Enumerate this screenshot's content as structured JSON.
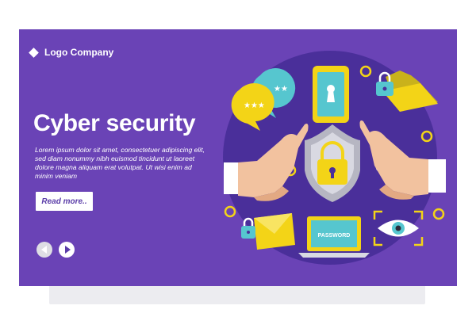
{
  "logo": {
    "text": "Logo Company"
  },
  "hero": {
    "title": "Cyber security",
    "body": "Lorem ipsum dolor sit amet, consectetuer adipiscing elit, sed diam nonummy nibh euismod tincidunt ut laoreet dolore magna aliquam erat volutpat. Ut wisi enim ad minim veniam",
    "read_more_label": "Read more.."
  },
  "illustration": {
    "laptop_screen_text": "PASSWORD",
    "icons": [
      "chat-bubble-icon",
      "phone-lock-icon",
      "folder-lock-icon",
      "shield-padlock-icon",
      "envelope-lock-icon",
      "laptop-password-icon",
      "eye-scan-icon",
      "left-hand-icon",
      "right-hand-icon"
    ]
  },
  "navigation": {
    "prev_icon": "arrow-left-icon",
    "next_icon": "arrow-right-icon"
  },
  "colors": {
    "banner_bg": "#6a43b6",
    "circle_bg": "#4a2f9a",
    "accent_yellow": "#f3d417",
    "accent_teal": "#56c6cf",
    "skin": "#f2c29f"
  }
}
